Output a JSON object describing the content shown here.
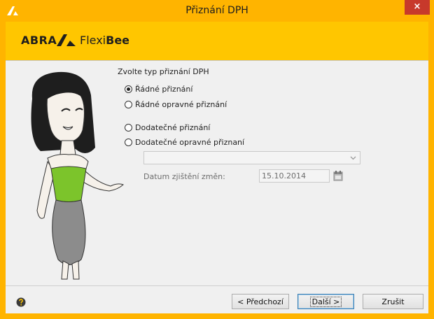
{
  "window": {
    "title": "Přiznání DPH",
    "close_label": "×"
  },
  "brand": {
    "abra": "ABRA",
    "flexi": "Flexi",
    "bee": "Bee"
  },
  "form": {
    "section_label": "Zvolte typ přiznání DPH",
    "options": [
      {
        "label": "Řádné přiznání",
        "selected": true
      },
      {
        "label": "Řádné opravné přiznání",
        "selected": false
      },
      {
        "label": "Dodatečné přiznání",
        "selected": false
      },
      {
        "label": "Dodatečné opravné přiznaní",
        "selected": false
      }
    ],
    "date_label": "Datum zjištění změn:",
    "date_value": "15.10.2014"
  },
  "buttons": {
    "prev": "< Předchozí",
    "next": "Další >",
    "cancel": "Zrušit"
  },
  "colors": {
    "frame": "#ffb400",
    "banner": "#ffc600",
    "close": "#c7392b",
    "dress_top": "#7cc42b",
    "skirt": "#8c8c8c"
  }
}
